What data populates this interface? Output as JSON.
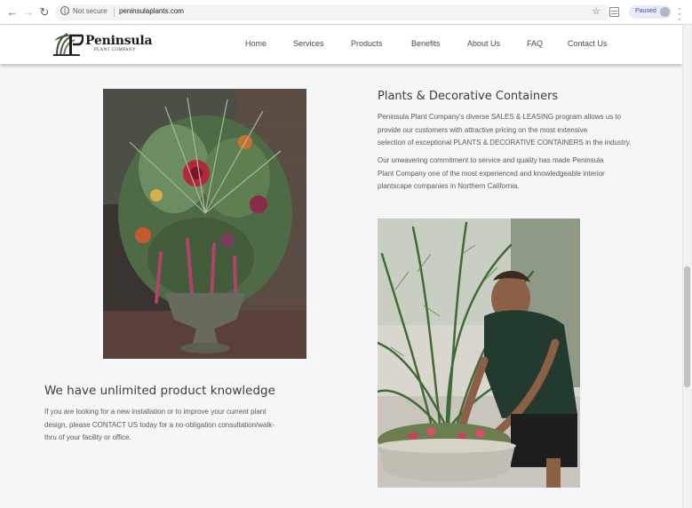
{
  "browser": {
    "security_label": "Not secure",
    "url": "peninsulaplants.com",
    "profile_status": "Paused"
  },
  "site": {
    "logo": {
      "name": "Peninsula",
      "subtitle": "PLANT COMPANY"
    },
    "nav": [
      "Home",
      "Services",
      "Products",
      "Benefits",
      "About Us",
      "FAQ",
      "Contact Us"
    ]
  },
  "section_containers": {
    "heading": "Plants & Decorative Containers",
    "paragraphs": [
      [
        "Peninsula Plant Company's diverse SALES & LEASING program allows us to",
        "provide our customers with attractive pricing on the most extensive",
        "selection of exceptional PLANTS & DECORATIVE CONTAINERS in the industry."
      ],
      [
        "Our unwavering commitment to service and quality has made Peninsula",
        "Plant Company one of the most experienced and knowledgeable interior",
        "plantscape companies in Northern California."
      ]
    ]
  },
  "section_knowledge": {
    "heading": "We have unlimited product knowledge",
    "lines": [
      "If you are looking for a new installation or to improve your current plant",
      "design, please CONTACT US today for a no-obligation consultation/walk-",
      "thru of your facility or office."
    ]
  },
  "colors": {
    "page_background": "#f6f6f8",
    "heading_text": "#3e3e3e",
    "body_text": "#5a5a5a",
    "paused_chip": "#e8eaf6"
  }
}
